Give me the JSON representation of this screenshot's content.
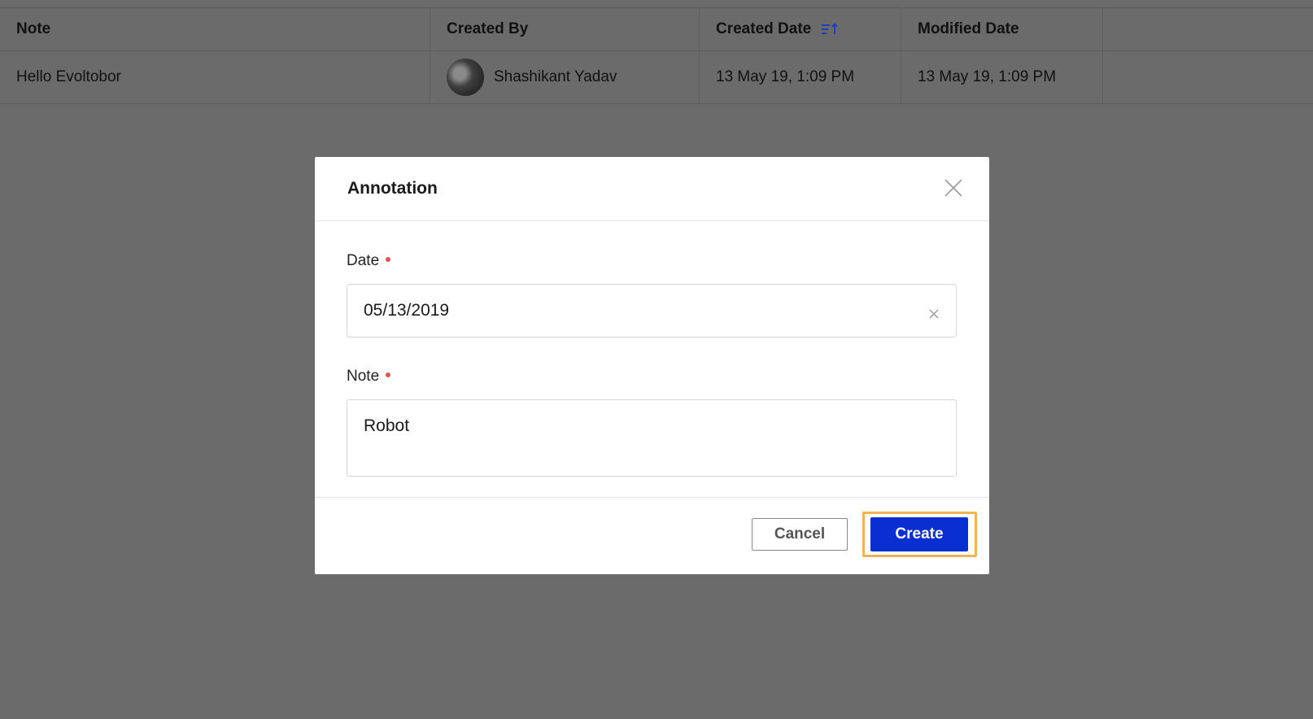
{
  "table": {
    "headers": {
      "note": "Note",
      "created_by": "Created By",
      "created_date": "Created Date",
      "modified_date": "Modified Date"
    },
    "rows": [
      {
        "note": "Hello Evoltobor",
        "created_by": "Shashikant Yadav",
        "created_date": "13 May 19, 1:09 PM",
        "modified_date": "13 May 19, 1:09 PM"
      }
    ],
    "sort_icon": "sort-ascending-icon"
  },
  "modal": {
    "title": "Annotation",
    "close_icon": "close-icon",
    "date_label": "Date",
    "date_value": "05/13/2019",
    "note_label": "Note",
    "note_value": "Robot",
    "cancel_label": "Cancel",
    "create_label": "Create"
  },
  "colors": {
    "primary_button": "#0a2fd1",
    "highlight": "#f0b454",
    "required_dot": "#e4514f",
    "sort_icon": "#1f3fbf"
  }
}
